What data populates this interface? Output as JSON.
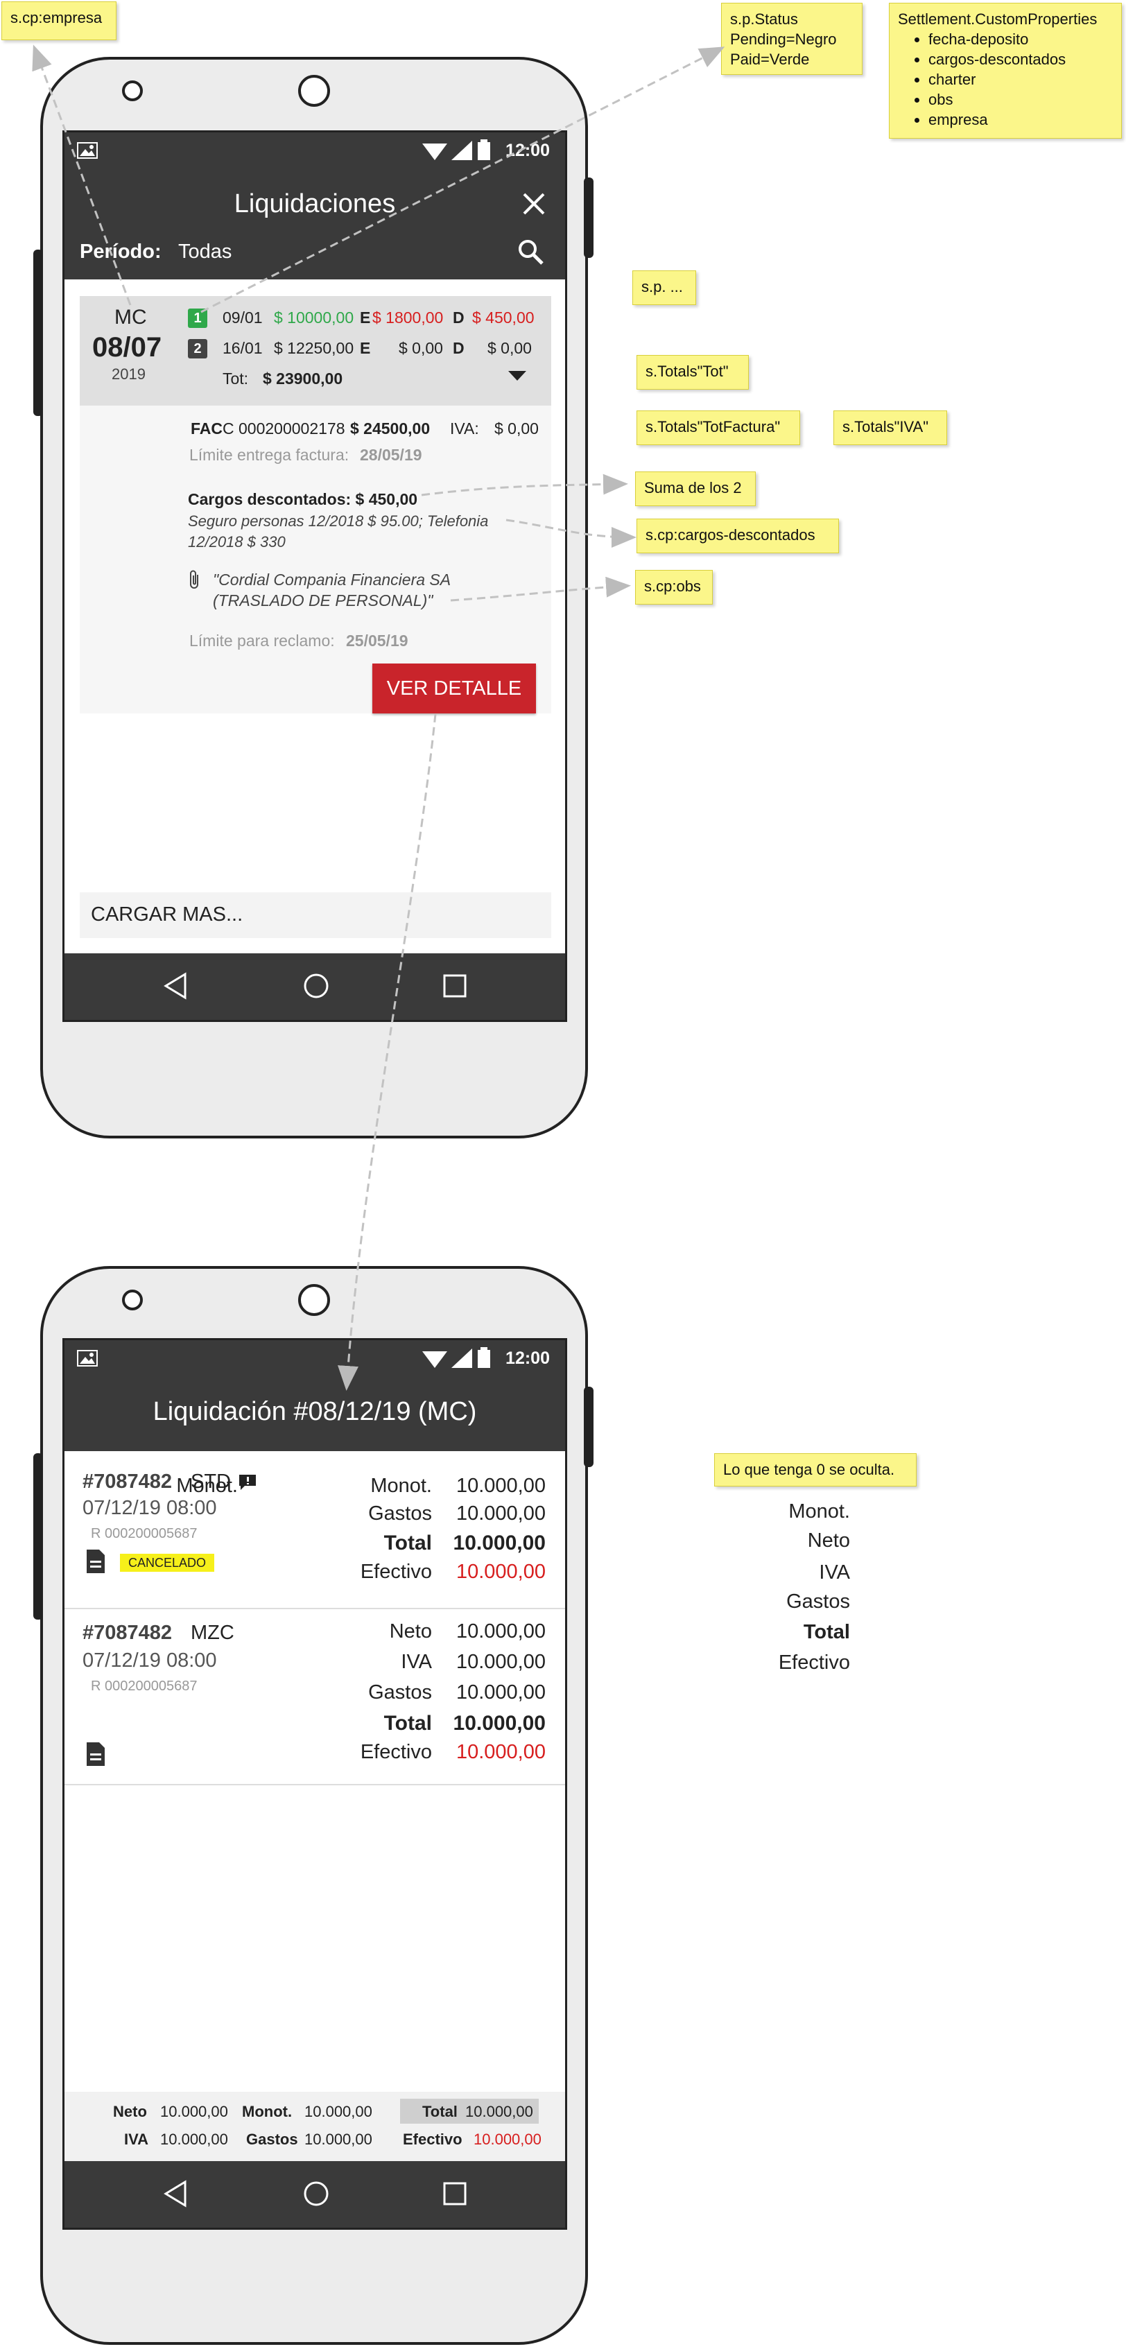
{
  "notes": {
    "scp_empresa": "s.cp:empresa",
    "sp_status": [
      "s.p.Status",
      "Pending=Negro",
      "Paid=Verde"
    ],
    "settlement_props_title": "Settlement.CustomProperties",
    "settlement_props_items": [
      "fecha-deposito",
      "cargos-descontados",
      "charter",
      "obs",
      "empresa"
    ],
    "sp_more": "s.p. ...",
    "totals_tot": "s.Totals\"Tot\"",
    "totals_totfactura": "s.Totals\"TotFactura\"",
    "totals_iva": "s.Totals\"IVA\"",
    "suma": "Suma de los 2",
    "cargos": "s.cp:cargos-descontados",
    "obs": "s.cp:obs",
    "zero_hidden": "Lo que tenga 0 se oculta."
  },
  "side_list": [
    "Monot.",
    "Neto",
    "IVA",
    "Gastos",
    "Total",
    "Efectivo"
  ],
  "phone1": {
    "time": "12:00",
    "title": "Liquidaciones",
    "period_label": "Período:",
    "period_value": "Todas",
    "card": {
      "company": "MC",
      "date": "08/07",
      "year": "2019",
      "row1": {
        "badge": "1",
        "date": "09/01",
        "amount": "$ 10000,00",
        "e_label": "E",
        "e_value": "$ 1800,00",
        "d_label": "D",
        "d_value": "$ 450,00"
      },
      "row2": {
        "badge": "2",
        "date": "16/01",
        "amount": "$ 12250,00",
        "e_label": "E",
        "e_value": "$ 0,00",
        "d_label": "D",
        "d_value": "$ 0,00"
      },
      "tot_label": "Tot:",
      "tot_value": "$ 23900,00"
    },
    "detail": {
      "fac_label": "FAC",
      "fac_number": "C 000200002178",
      "fac_amount": "$ 24500,00",
      "iva_label": "IVA:",
      "iva_value": "$ 0,00",
      "limit_invoice_label": "Límite entrega factura:",
      "limit_invoice_value": "28/05/19",
      "cargos_label": "Cargos descontados: $ 450,00",
      "cargos_line1": "Seguro personas 12/2018 $ 95.00; Telefonia",
      "cargos_line2": "12/2018 $ 330",
      "obs_line1": "\"Cordial Compania Financiera SA",
      "obs_line2": "(TRASLADO DE PERSONAL)\"",
      "limit_claim_label": "Límite para reclamo:",
      "limit_claim_value": "25/05/19",
      "button": "VER DETALLE"
    },
    "load_more": "CARGAR MAS..."
  },
  "phone2": {
    "time": "12:00",
    "title": "Liquidación #08/12/19 (MC)",
    "items": [
      {
        "id": "#7087482",
        "type": "STD",
        "datetime": "07/12/19 08:00",
        "ref": "R 000200005687",
        "status": "CANCELADO",
        "labels": [
          "Monot.",
          "Gastos",
          "Total",
          "Efectivo"
        ],
        "values": [
          "10.000,00",
          "10.000,00",
          "10.000,00",
          "10.000,00"
        ]
      },
      {
        "id": "#7087482",
        "type": "MZC",
        "datetime": "07/12/19 08:00",
        "ref": "R 000200005687",
        "labels": [
          "Neto",
          "IVA",
          "Gastos",
          "Total",
          "Efectivo"
        ],
        "values": [
          "10.000,00",
          "10.000,00",
          "10.000,00",
          "10.000,00",
          "10.000,00"
        ]
      }
    ],
    "footer": {
      "neto_label": "Neto",
      "neto_value": "10.000,00",
      "monot_label": "Monot.",
      "monot_value": "10.000,00",
      "total_label": "Total",
      "total_value": "10.000,00",
      "iva_label": "IVA",
      "iva_value": "10.000,00",
      "gastos_label": "Gastos",
      "gastos_value": "10.000,00",
      "efectivo_label": "Efectivo",
      "efectivo_value": "10.000,00"
    }
  },
  "colors": {
    "appbar": "#3a3a3a",
    "accent_red": "#c9242b",
    "paid_green": "#2fa84a",
    "note_yellow": "#fbf68a"
  }
}
